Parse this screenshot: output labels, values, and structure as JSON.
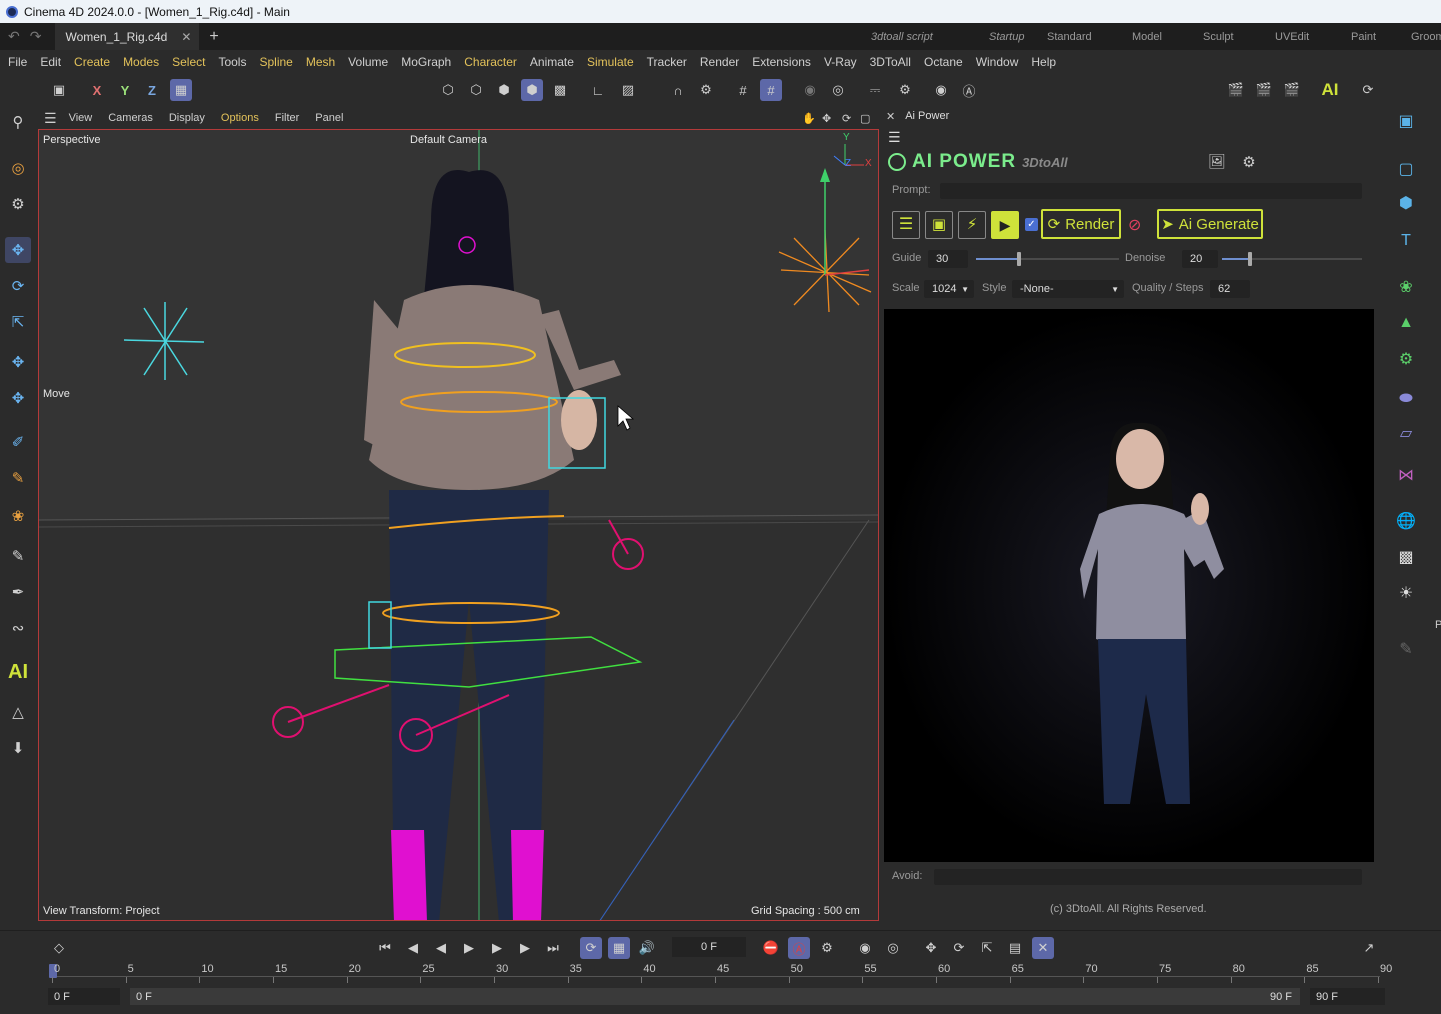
{
  "window": {
    "title": "Cinema 4D 2024.0.0 - [Women_1_Rig.c4d] - Main"
  },
  "tabs": {
    "document": "Women_1_Rig.c4d"
  },
  "layouts": [
    "3dtoall script",
    "Startup",
    "Standard",
    "Model",
    "Sculpt",
    "UVEdit",
    "Paint",
    "Groom"
  ],
  "menu": [
    "File",
    "Edit",
    "Create",
    "Modes",
    "Select",
    "Tools",
    "Spline",
    "Mesh",
    "Volume",
    "MoGraph",
    "Character",
    "Animate",
    "Simulate",
    "Tracker",
    "Render",
    "Extensions",
    "V-Ray",
    "3DToAll",
    "Octane",
    "Window",
    "Help"
  ],
  "toolbar": {
    "x": "X",
    "y": "Y",
    "z": "Z",
    "ai": "AI"
  },
  "viewport": {
    "menu": [
      "View",
      "Cameras",
      "Display",
      "Options",
      "Filter",
      "Panel"
    ],
    "projection": "Perspective",
    "camera": "Default Camera",
    "tool": "Move",
    "view_transform": "View Transform: Project",
    "grid_spacing": "Grid Spacing : 500 cm",
    "axis_y": "Y",
    "axis_x": "X",
    "axis_z": "Z"
  },
  "ai_panel": {
    "tab_title": "Ai Power",
    "brand": "AI POWER",
    "brand_sub": "3DtoAll",
    "prompt_label": "Prompt:",
    "render_label": "Render",
    "generate_label": "Ai Generate",
    "guide_label": "Guide",
    "guide_value": "30",
    "guide_level": 0.3,
    "denoise_label": "Denoise",
    "denoise_value": "20",
    "denoise_level": 0.2,
    "scale_label": "Scale",
    "scale_value": "1024",
    "style_label": "Style",
    "style_value": "-None-",
    "quality_label": "Quality / Steps",
    "quality_value": "62",
    "avoid_label": "Avoid:",
    "copyright": "(c) 3DtoAll. All Rights Reserved."
  },
  "left_tools": {
    "ai": "AI"
  },
  "timeline": {
    "current_frame": "0 F",
    "ruler": [
      "0",
      "5",
      "10",
      "15",
      "20",
      "25",
      "30",
      "35",
      "40",
      "45",
      "50",
      "55",
      "60",
      "65",
      "70",
      "75",
      "80",
      "85",
      "90"
    ],
    "start": "0 F",
    "range_start": "0 F",
    "range_end": "90 F",
    "end": "90 F"
  },
  "right_panel": {
    "partial_label": "P"
  },
  "colors": {
    "accent": "#5d68a8",
    "ai_green": "#7bec8c",
    "ai_button": "#cfe23a",
    "viewport_border": "#b43a3a"
  }
}
